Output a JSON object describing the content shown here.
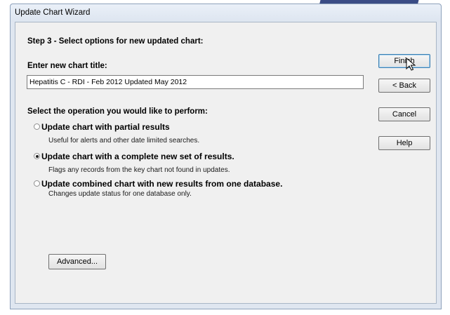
{
  "window": {
    "title": "Update Chart Wizard"
  },
  "wizard": {
    "step_heading": "Step 3 - Select options for new updated chart:",
    "chart_title_label": "Enter new chart title:",
    "chart_title_value": "Hepatitis C - RDI - Feb 2012 Updated May 2012",
    "operation_label": "Select the operation you would like to perform:",
    "options": [
      {
        "label": "Update chart with partial results",
        "description": "Useful for alerts and other date limited searches.",
        "selected": false
      },
      {
        "label": "Update chart with a complete new set of results.",
        "description": "Flags any records from the key chart not found in updates.",
        "selected": true
      },
      {
        "label": "Update combined chart with new results from one database.",
        "description": "Changes update status for one database only.",
        "selected": false
      }
    ],
    "advanced_button": "Advanced..."
  },
  "buttons": {
    "finish": "Finish",
    "back": "< Back",
    "cancel": "Cancel",
    "help": "Help"
  },
  "icons": {
    "cursor": "mouse-pointer-icon",
    "radio": "radio-button-icon"
  },
  "colors": {
    "banner": "#3a4c86",
    "window_frame": "#dfe6f0",
    "client_bg": "#f0f0f0",
    "default_button_border": "#3c7fb1"
  }
}
